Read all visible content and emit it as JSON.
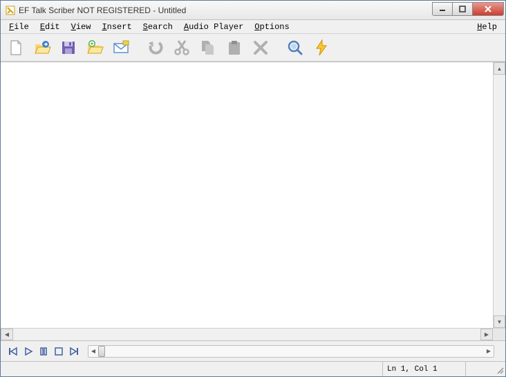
{
  "window": {
    "title": "EF Talk Scriber NOT REGISTERED - Untitled"
  },
  "menu": {
    "file": "File",
    "edit": "Edit",
    "view": "View",
    "insert": "Insert",
    "search": "Search",
    "audio": "Audio Player",
    "options": "Options",
    "help": "Help"
  },
  "toolbar": {
    "new": "new-file",
    "open": "open-file",
    "save": "save-file",
    "open_audio": "open-audio",
    "mail": "send-mail",
    "undo": "undo",
    "cut": "cut",
    "copy": "copy",
    "paste": "paste",
    "delete": "delete",
    "find": "find",
    "bolt": "quick-action"
  },
  "status": {
    "position": "Ln 1, Col 1"
  },
  "player": {
    "first": "first",
    "play": "play",
    "pause": "pause",
    "stop": "stop",
    "last": "last"
  }
}
